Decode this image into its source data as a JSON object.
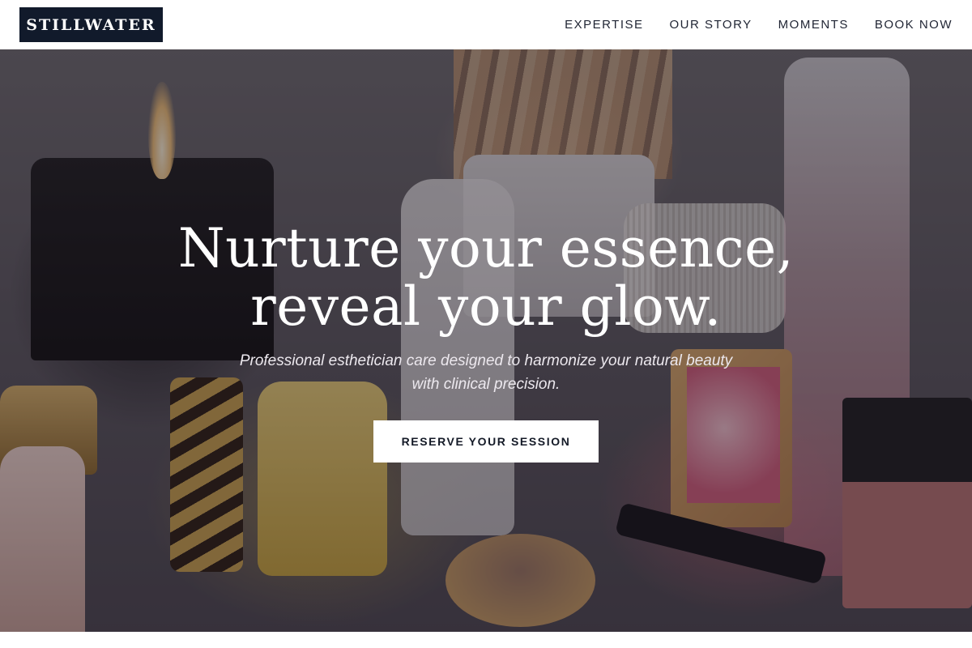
{
  "header": {
    "logo": "STILLWATER",
    "nav": [
      {
        "label": "EXPERTISE"
      },
      {
        "label": "OUR STORY"
      },
      {
        "label": "MOMENTS"
      },
      {
        "label": "BOOK NOW"
      }
    ]
  },
  "hero": {
    "title_line1": "Nurture your essence,",
    "title_line2": "reveal your glow.",
    "subtitle_line1": "Professional esthetician care designed to harmonize your natural beauty",
    "subtitle_line2": "with clinical precision.",
    "cta_label": "RESERVE YOUR SESSION",
    "background_image": "cosmetics-vanity-photo"
  },
  "colors": {
    "logo_bg": "#111a2b",
    "nav_text": "#1f2433",
    "cta_bg": "#ffffff",
    "cta_text": "#141a27",
    "hero_overlay": "#1c1620"
  }
}
